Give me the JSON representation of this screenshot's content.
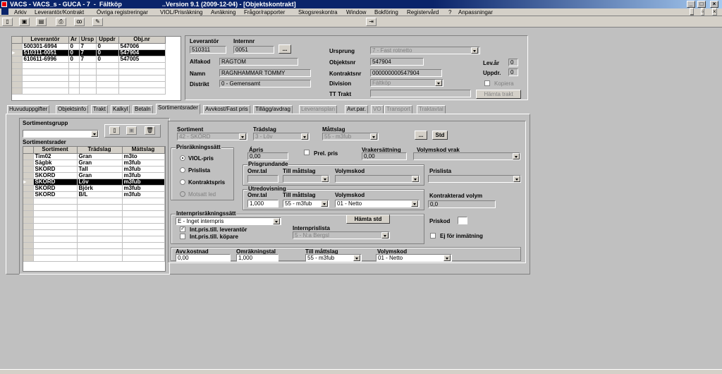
{
  "title_left": "VACS - VACS_s - GUCA - 7  -  Fältköp",
  "title_right": "..Version 9.1 (2009-12-04) - [Objektskontrakt]",
  "menu": [
    "Arkiv",
    "Leverantör/Kontrakt",
    "Övriga registreringar",
    "VIOL/Prisräkning",
    "Avräkning",
    "Frågor/rapporter",
    "Skogsreskontra",
    "Window",
    "Bokföring",
    "Registervård",
    "?",
    "Anpassningar"
  ],
  "top_grid": {
    "headers": [
      "Leverantör",
      "År",
      "Ursp",
      "Uppdr",
      "Obj.nr"
    ],
    "rows": [
      [
        "500301-6994",
        "0",
        "7",
        "0",
        "547006"
      ],
      [
        "510311-0051",
        "0",
        "7",
        "0",
        "547904"
      ],
      [
        "610611-6996",
        "0",
        "7",
        "0",
        "547005"
      ]
    ]
  },
  "header": {
    "leverantor_label": "Leverantör",
    "internnr_label": "Internnr",
    "leverantor": "510311",
    "internnr": "0051",
    "ellipsis": "...",
    "alfakod_label": "Alfakod",
    "alfakod": "RAGTOM",
    "namn_label": "Namn",
    "namn": "RAGNHAMMAR TOMMY",
    "distrikt_label": "Distrikt",
    "distrikt": "0   - Gemensamt",
    "ursprung_label": "Ursprung",
    "ursprung": "7  - Fast rotnetto",
    "objektsnr_label": "Objektsnr",
    "objektsnr": "547904",
    "kontraktsnr_label": "Kontraktsnr",
    "kontraktsnr": "000000000547904",
    "division_label": "Division",
    "division": "Fältköp",
    "tt_trakt_label": "TT Trakt",
    "lev_ar_label": "Lev.år",
    "lev_ar": "0",
    "uppdr_label": "Uppdr.",
    "uppdr": "0",
    "kopiera_label": "Kopiera",
    "hamta_trakt": "Hämta trakt"
  },
  "tabs": [
    "Huvuduppgifter",
    "Objektsinfo",
    "Trakt",
    "Kalkyl",
    "Betaln",
    "Sortimentsrader",
    "Avvkost/Fast pris",
    "Tillägg/avdrag",
    "Leveransplan",
    "Avr.par.",
    "VO",
    "Transport",
    "Traktavtal"
  ],
  "left": {
    "sortimentsgrupp_label": "Sortimentsgrupp",
    "sortimentsrader_label": "Sortimentsrader",
    "headers": [
      "Sortiment",
      "Trädslag",
      "Måttslag"
    ],
    "rows": [
      [
        "Tim02",
        "Gran",
        "m3to"
      ],
      [
        "Sågbk",
        "Gran",
        "m3fub"
      ],
      [
        "SKÖRD",
        "Tall",
        "m3fub"
      ],
      [
        "SKÖRD",
        "Gran",
        "m3fub"
      ],
      [
        "SKÖRD",
        "Löv",
        "m3fub"
      ],
      [
        "SKÖRD",
        "Björk",
        "m3fub"
      ],
      [
        "SKÖRD",
        "B/L",
        "m3fub"
      ]
    ]
  },
  "right": {
    "sortiment_label": "Sortiment",
    "sortiment": "42 - SKÖRD",
    "tradslag_label": "Trädslag",
    "tradslag": "3 - Löv",
    "mattslag_label": "Måttslag",
    "mattslag": "55 - m3fub",
    "ellipsis": "...",
    "std": "Std",
    "prisrakningssatt_label": "Prisräkningssätt",
    "radios": [
      "VIOL-pris",
      "Prislista",
      "Kontraktspris",
      "Motsatt led"
    ],
    "apris_label": "Ápris",
    "apris": "0,00",
    "prel_pris_label": "Prel. pris",
    "vrakersattning_label": "Vrakersättning",
    "vrakersattning": "0,00",
    "volymskod_vrak_label": "Volymskod vrak",
    "prisgrundande_label": "Prisgrundande",
    "omr_tal_label": "Omr.tal",
    "till_mattslag_label": "Till måttslag",
    "volymskod_label": "Volymskod",
    "prislista_label": "Prislista",
    "utredovisning_label": "Utredovisning",
    "omr_tal": "1,000",
    "till_mattslag": "55 - m3fub",
    "volymskod": "01 - Netto",
    "kontrakterad_volym_label": "Kontrakterad volym",
    "kontrakterad_volym": "0,0",
    "internprisrakningssatt_label": "Internprisräkningssätt",
    "internpris": "E - Inget internpris",
    "hamta_std": "Hämta std",
    "int_lev_label": "Int.pris.till. leverantör",
    "int_kop_label": "Int.pris.till. köpare",
    "internprislista_label": "Internprislista",
    "internprislista": "5     - N:a Bergsl",
    "priskod_label": "Priskod",
    "ej_inmatning_label": "Ej för inmätning",
    "avv_kostnad_label": "Avv.kostnad",
    "avv_kostnad": "0,00",
    "omrakningstal_label": "Omräkningstal",
    "omrakningstal": "1,000",
    "b_till_mattslag_label": "Till måttslag",
    "b_till_mattslag": "55 - m3fub",
    "b_volymskod_label": "Volymskod",
    "b_volymskod": "01 - Netto"
  }
}
